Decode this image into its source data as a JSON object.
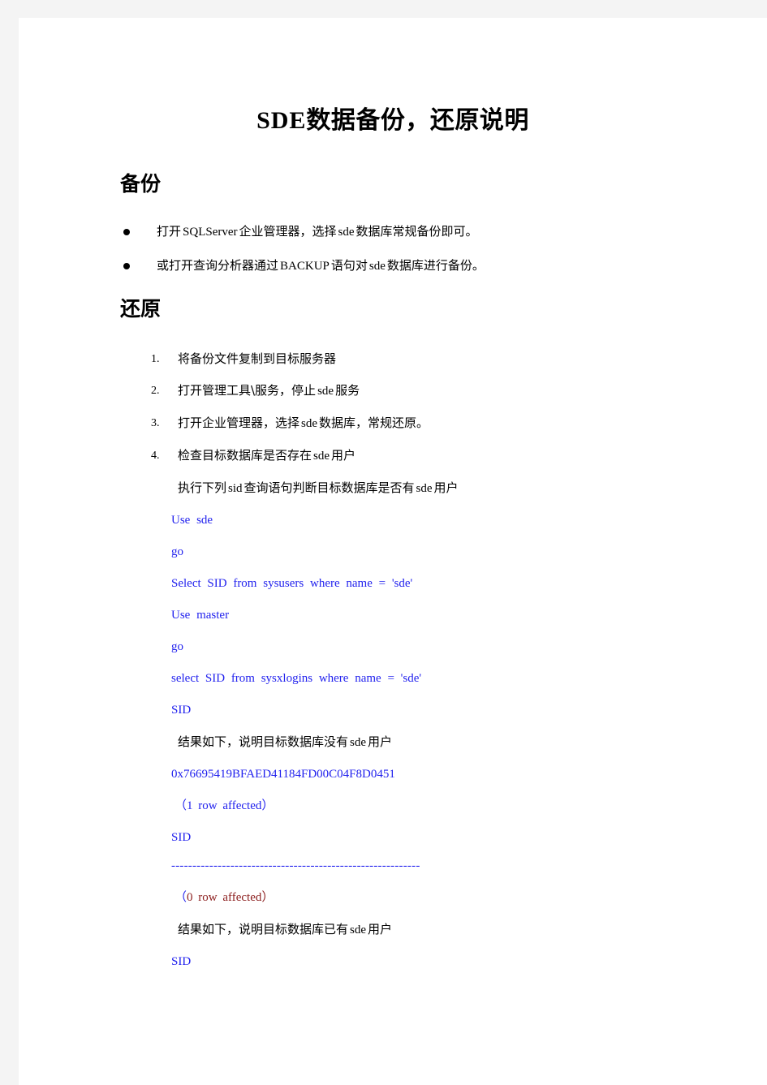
{
  "document": {
    "title_latin": "SDE",
    "title_cjk": "数据备份，还原说明"
  },
  "sections": {
    "backup": {
      "heading": "备份",
      "bullets": [
        {
          "parts": [
            {
              "text": "打开",
              "script": "cjk"
            },
            {
              "text": "SQLServer",
              "script": "latin"
            },
            {
              "text": "企业管理器，选择",
              "script": "cjk"
            },
            {
              "text": "sde",
              "script": "latin"
            },
            {
              "text": "数据库常规备份即可。",
              "script": "cjk"
            }
          ]
        },
        {
          "parts": [
            {
              "text": "或打开查询分析器通过",
              "script": "cjk"
            },
            {
              "text": "BACKUP",
              "script": "latin"
            },
            {
              "text": "语句对",
              "script": "cjk"
            },
            {
              "text": "sde",
              "script": "latin"
            },
            {
              "text": "数据库进行备份。",
              "script": "cjk"
            }
          ]
        }
      ]
    },
    "restore": {
      "heading": "还原",
      "steps": [
        {
          "number": "1.",
          "parts": [
            {
              "text": "将备份文件复制到目标服务器",
              "script": "cjk"
            }
          ]
        },
        {
          "number": "2.",
          "parts": [
            {
              "text": "打开管理工具\\服务，停止",
              "script": "cjk"
            },
            {
              "text": "sde",
              "script": "latin"
            },
            {
              "text": "服务",
              "script": "cjk"
            }
          ]
        },
        {
          "number": "3.",
          "parts": [
            {
              "text": "打开企业管理器，选择",
              "script": "cjk"
            },
            {
              "text": "sde",
              "script": "latin"
            },
            {
              "text": "数据库，常规还原。",
              "script": "cjk"
            }
          ]
        },
        {
          "number": "4.",
          "parts": [
            {
              "text": "检查目标数据库是否存在",
              "script": "cjk"
            },
            {
              "text": "sde",
              "script": "latin"
            },
            {
              "text": "用户",
              "script": "cjk"
            }
          ]
        }
      ],
      "step4_detail": {
        "instruction_parts": [
          {
            "text": "执行下列",
            "script": "cjk"
          },
          {
            "text": "sid",
            "script": "latin"
          },
          {
            "text": "查询语句判断目标数据库是否有",
            "script": "cjk"
          },
          {
            "text": "sde",
            "script": "latin"
          },
          {
            "text": "用户",
            "script": "cjk"
          }
        ],
        "sql_lines": [
          "Use sde",
          "go",
          "Select SID from sysusers where name = 'sde'",
          "Use master",
          "go",
          "select SID from sysxlogins where name = 'sde'"
        ],
        "result_block_1": {
          "column_header": "SID",
          "note_parts": [
            {
              "text": "结果如下，说明目标数据库没有",
              "script": "cjk"
            },
            {
              "text": "sde",
              "script": "latin"
            },
            {
              "text": "用户",
              "script": "cjk"
            }
          ],
          "sid_value": "0x76695419BFAED41184FD00C04F8D0451",
          "rows_affected_prefix": "（",
          "rows_affected_count": "1",
          "rows_affected_suffix": " row affected）"
        },
        "result_block_2": {
          "column_header": "SID",
          "separator": "-----------------------------------------------------------",
          "rows_affected_prefix": "（",
          "rows_affected_count": "0",
          "rows_affected_suffix": " row affected）",
          "note_parts": [
            {
              "text": "结果如下，说明目标数据库已有",
              "script": "cjk"
            },
            {
              "text": "sde",
              "script": "latin"
            },
            {
              "text": "用户",
              "script": "cjk"
            }
          ],
          "trailing_column_header": "SID"
        }
      }
    }
  },
  "colors": {
    "page_background": "#ffffff",
    "canvas_background": "#f4f4f4",
    "body_text": "#000000",
    "code_blue": "#2222ee",
    "warning_red": "#8d2020"
  }
}
